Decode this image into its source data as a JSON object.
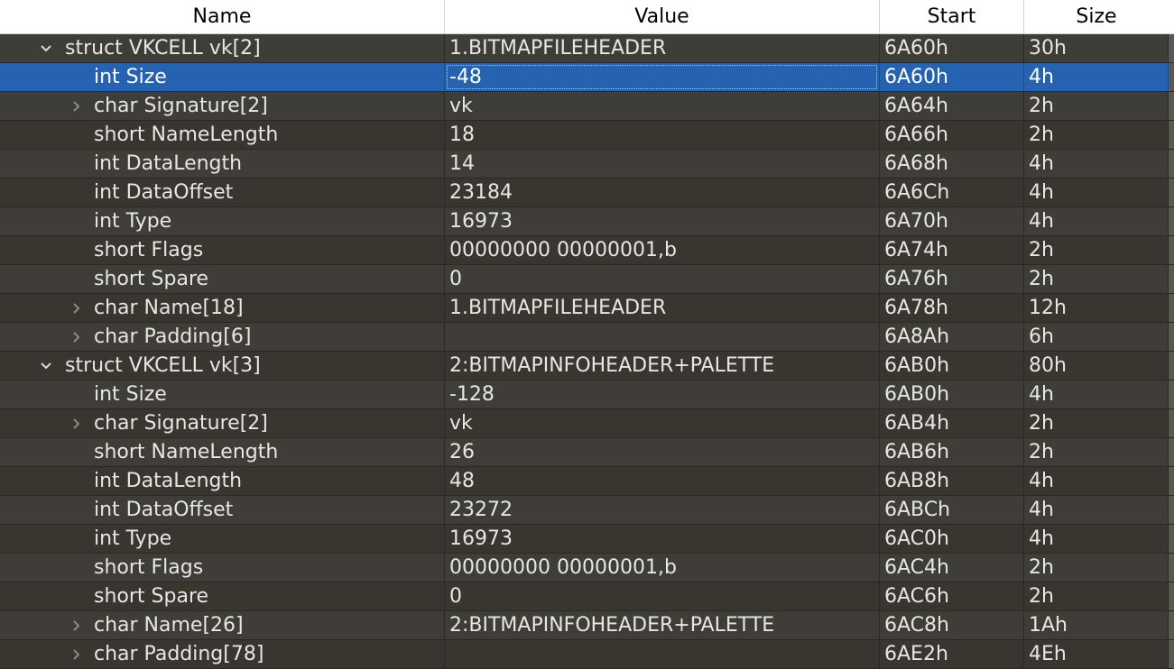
{
  "columns": [
    "Name",
    "Value",
    "Start",
    "Size"
  ],
  "rows": [
    {
      "name": "struct VKCELL vk[2]",
      "value": "1.BITMAPFILEHEADER",
      "start": "6A60h",
      "size": "30h",
      "level": 0,
      "expander": "expanded",
      "selected": false
    },
    {
      "name": "int Size",
      "value": "-48",
      "start": "6A60h",
      "size": "4h",
      "level": 1,
      "expander": "none",
      "selected": true
    },
    {
      "name": "char Signature[2]",
      "value": "vk",
      "start": "6A64h",
      "size": "2h",
      "level": 1,
      "expander": "collapsed",
      "selected": false
    },
    {
      "name": "short NameLength",
      "value": "18",
      "start": "6A66h",
      "size": "2h",
      "level": 1,
      "expander": "none",
      "selected": false
    },
    {
      "name": "int DataLength",
      "value": "14",
      "start": "6A68h",
      "size": "4h",
      "level": 1,
      "expander": "none",
      "selected": false
    },
    {
      "name": "int DataOffset",
      "value": "23184",
      "start": "6A6Ch",
      "size": "4h",
      "level": 1,
      "expander": "none",
      "selected": false
    },
    {
      "name": "int Type",
      "value": "16973",
      "start": "6A70h",
      "size": "4h",
      "level": 1,
      "expander": "none",
      "selected": false
    },
    {
      "name": "short Flags",
      "value": "00000000 00000001,b",
      "start": "6A74h",
      "size": "2h",
      "level": 1,
      "expander": "none",
      "selected": false
    },
    {
      "name": "short Spare",
      "value": "0",
      "start": "6A76h",
      "size": "2h",
      "level": 1,
      "expander": "none",
      "selected": false
    },
    {
      "name": "char Name[18]",
      "value": "1.BITMAPFILEHEADER",
      "start": "6A78h",
      "size": "12h",
      "level": 1,
      "expander": "collapsed",
      "selected": false
    },
    {
      "name": "char Padding[6]",
      "value": "",
      "start": "6A8Ah",
      "size": "6h",
      "level": 1,
      "expander": "collapsed",
      "selected": false
    },
    {
      "name": "struct VKCELL vk[3]",
      "value": "2:BITMAPINFOHEADER+PALETTE",
      "start": "6AB0h",
      "size": "80h",
      "level": 0,
      "expander": "expanded",
      "selected": false
    },
    {
      "name": "int Size",
      "value": "-128",
      "start": "6AB0h",
      "size": "4h",
      "level": 1,
      "expander": "none",
      "selected": false
    },
    {
      "name": "char Signature[2]",
      "value": "vk",
      "start": "6AB4h",
      "size": "2h",
      "level": 1,
      "expander": "collapsed",
      "selected": false
    },
    {
      "name": "short NameLength",
      "value": "26",
      "start": "6AB6h",
      "size": "2h",
      "level": 1,
      "expander": "none",
      "selected": false
    },
    {
      "name": "int DataLength",
      "value": "48",
      "start": "6AB8h",
      "size": "4h",
      "level": 1,
      "expander": "none",
      "selected": false
    },
    {
      "name": "int DataOffset",
      "value": "23272",
      "start": "6ABCh",
      "size": "4h",
      "level": 1,
      "expander": "none",
      "selected": false
    },
    {
      "name": "int Type",
      "value": "16973",
      "start": "6AC0h",
      "size": "4h",
      "level": 1,
      "expander": "none",
      "selected": false
    },
    {
      "name": "short Flags",
      "value": "00000000 00000001,b",
      "start": "6AC4h",
      "size": "2h",
      "level": 1,
      "expander": "none",
      "selected": false
    },
    {
      "name": "short Spare",
      "value": "0",
      "start": "6AC6h",
      "size": "2h",
      "level": 1,
      "expander": "none",
      "selected": false
    },
    {
      "name": "char Name[26]",
      "value": "2:BITMAPINFOHEADER+PALETTE",
      "start": "6AC8h",
      "size": "1Ah",
      "level": 1,
      "expander": "collapsed",
      "selected": false
    },
    {
      "name": "char Padding[78]",
      "value": "",
      "start": "6AE2h",
      "size": "4Eh",
      "level": 1,
      "expander": "collapsed",
      "selected": false
    }
  ],
  "colors": {
    "selection": "#2563b0",
    "row_bg": "#3f3d37",
    "row_bg_alt": "#38362f",
    "text": "#e6e6e6"
  }
}
